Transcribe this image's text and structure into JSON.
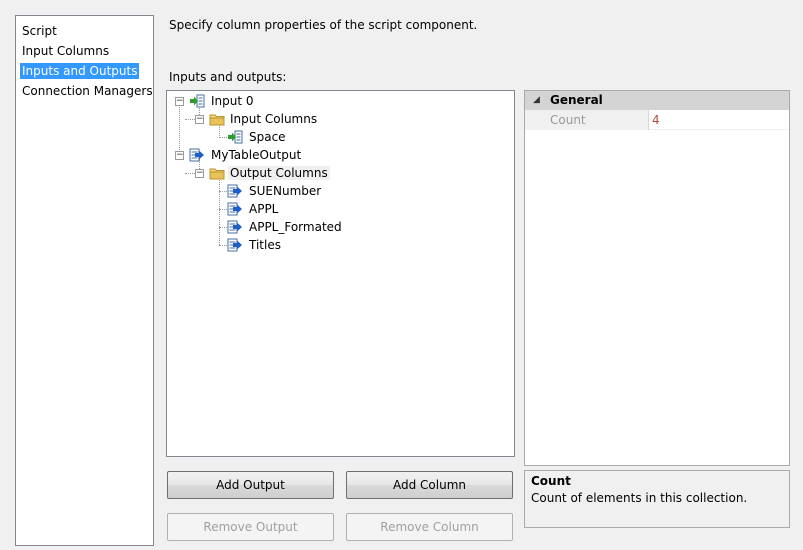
{
  "nav": {
    "items": [
      {
        "label": "Script",
        "selected": false
      },
      {
        "label": "Input Columns",
        "selected": false
      },
      {
        "label": "Inputs and Outputs",
        "selected": true
      },
      {
        "label": "Connection Managers",
        "selected": false
      }
    ]
  },
  "description": "Specify column properties of the script component.",
  "io_label": "Inputs and outputs:",
  "tree": {
    "input0": "Input 0",
    "input_columns": "Input Columns",
    "space": "Space",
    "output": "MyTableOutput",
    "output_columns": "Output Columns",
    "col_suenumber": "SUENumber",
    "col_appl": "APPL",
    "col_appl_formated": "APPL_Formated",
    "col_titles": "Titles",
    "collapse_glyph": "−"
  },
  "properties": {
    "category": "General",
    "collapse_glyph": "◢",
    "rows": [
      {
        "name": "Count",
        "value": "4"
      }
    ]
  },
  "help": {
    "title": "Count",
    "description": "Count of elements in this collection."
  },
  "buttons": {
    "add_output": "Add Output",
    "add_column": "Add Column",
    "remove_output": "Remove Output",
    "remove_column": "Remove Column"
  },
  "colors": {
    "selection": "#3399ff",
    "property_value": "#b94a3d",
    "input_arrow": "#2e9f2e",
    "output_arrow": "#1e5fc7",
    "folder": "#e8c25a"
  },
  "icons": {
    "input": "input-icon",
    "output": "output-icon",
    "folder": "folder-icon",
    "input_column": "input-column-icon",
    "output_column": "output-column-icon"
  }
}
